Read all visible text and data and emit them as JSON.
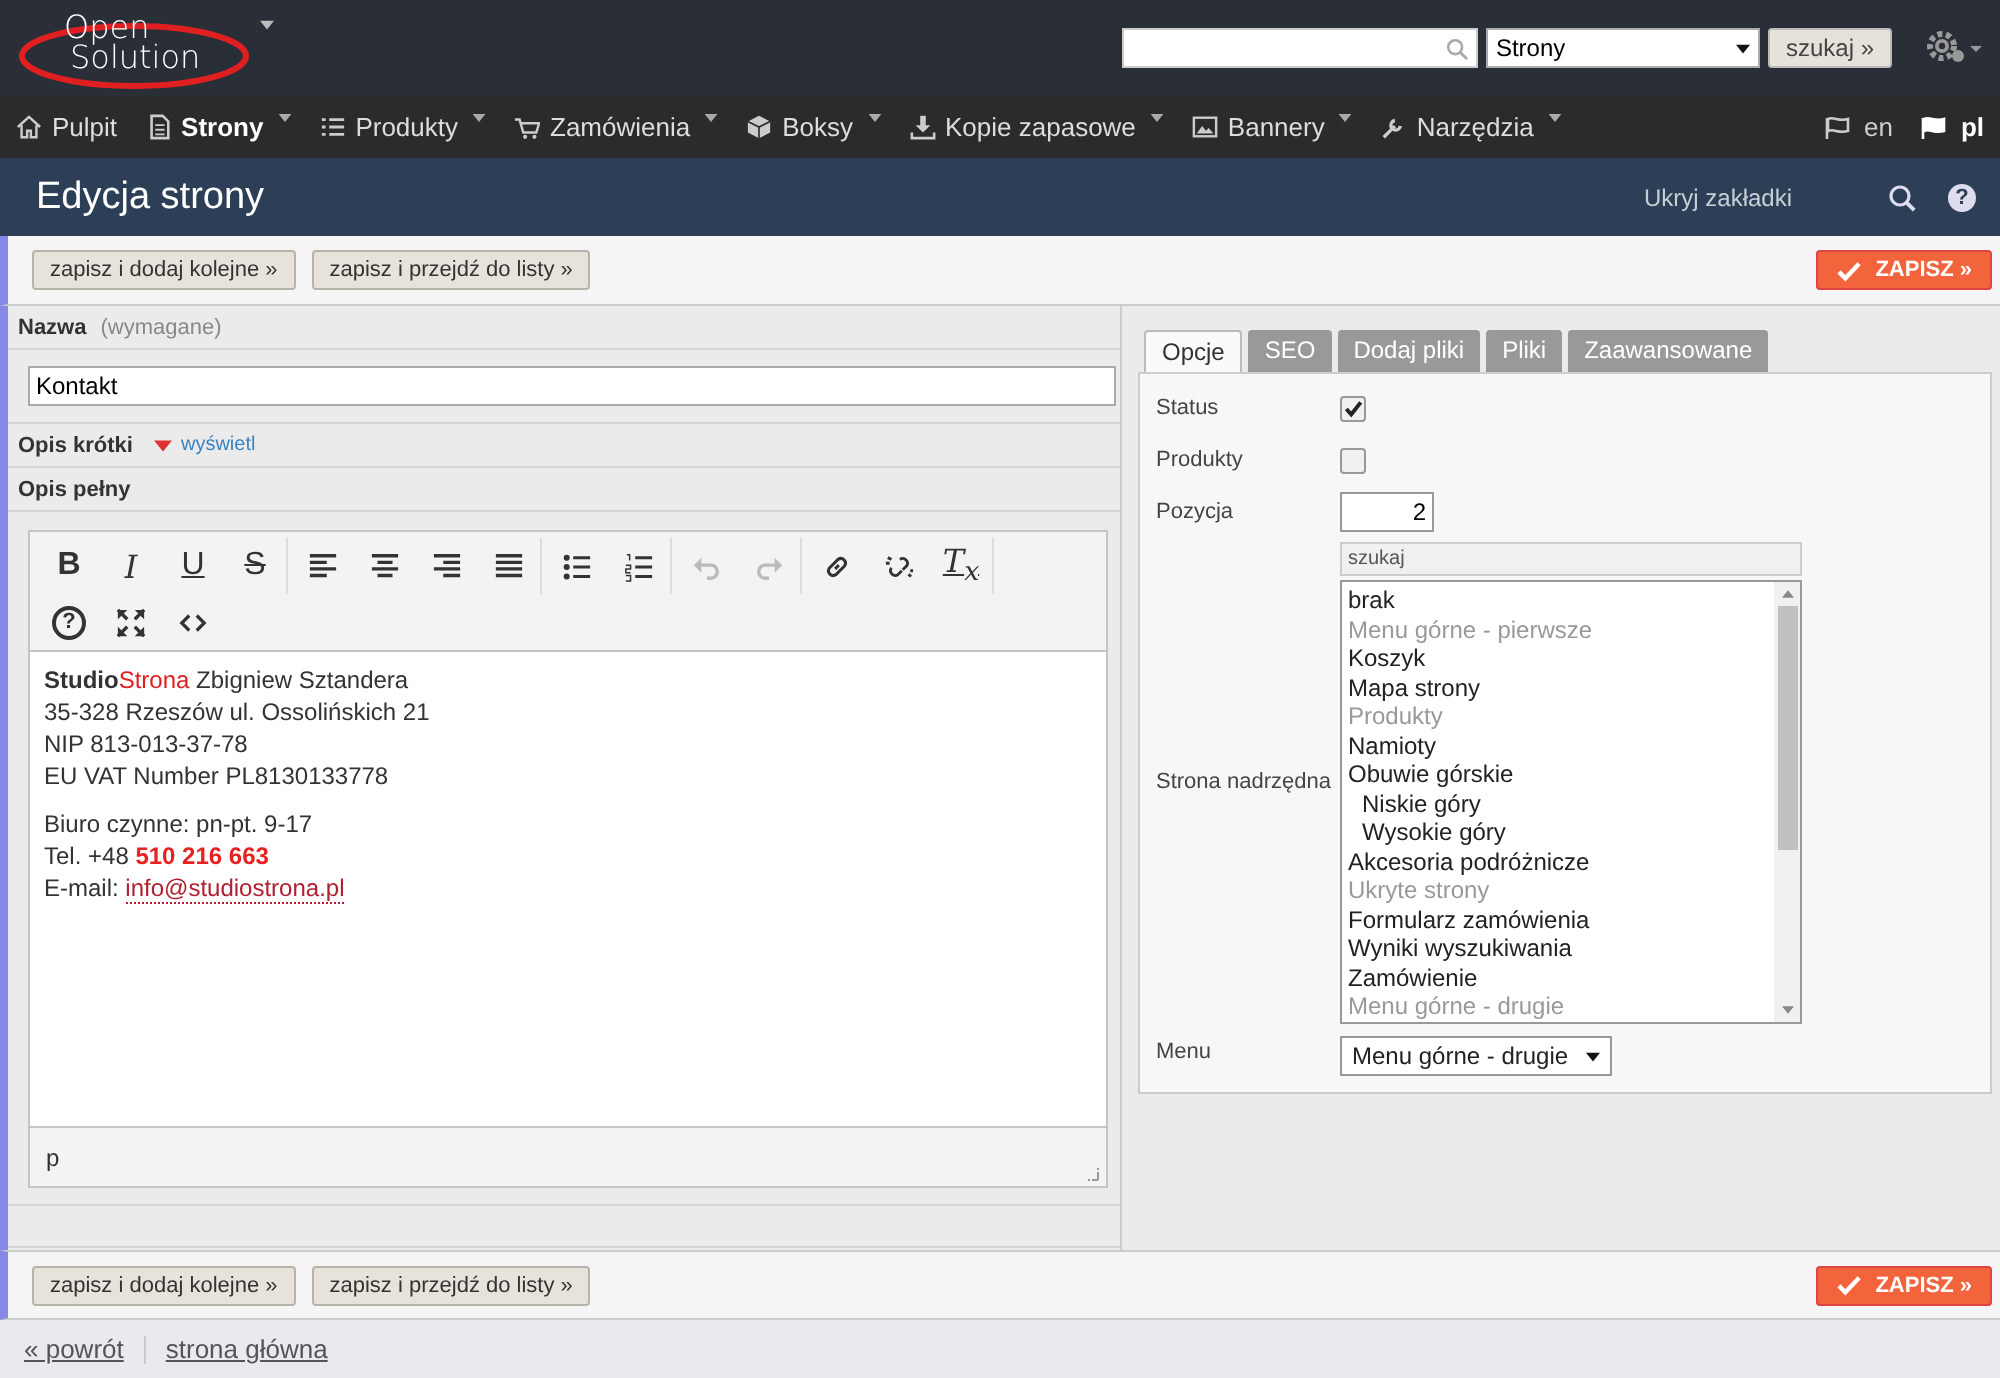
{
  "header": {
    "logo": [
      "Open",
      "Solution"
    ],
    "scope": "Strony",
    "search_button": "szukaj »"
  },
  "nav": {
    "items": [
      {
        "label": "Pulpit",
        "selected": false,
        "has_menu": false
      },
      {
        "label": "Strony",
        "selected": true,
        "has_menu": true
      },
      {
        "label": "Produkty",
        "selected": false,
        "has_menu": true
      },
      {
        "label": "Zamówienia",
        "selected": false,
        "has_menu": true
      },
      {
        "label": "Boksy",
        "selected": false,
        "has_menu": true
      },
      {
        "label": "Kopie zapasowe",
        "selected": false,
        "has_menu": true
      },
      {
        "label": "Bannery",
        "selected": false,
        "has_menu": true
      },
      {
        "label": "Narzędzia",
        "selected": false,
        "has_menu": true
      }
    ],
    "languages": [
      {
        "label": "en",
        "selected": false
      },
      {
        "label": "pl",
        "selected": true
      }
    ]
  },
  "title_bar": {
    "title": "Edycja strony",
    "hide_tabs": "Ukryj zakładki",
    "help": "?"
  },
  "actions": [
    "zapisz i dodaj kolejne »",
    "zapisz i przejdź do listy »"
  ],
  "save": "ZAPISZ »",
  "name_field": {
    "label": "Nazwa",
    "hint": "(wymagane)",
    "value": "Kontakt"
  },
  "short_description": {
    "label": "Opis krótki",
    "toggle": "wyświetl"
  },
  "full_description": {
    "label": "Opis pełny",
    "toolbar": [
      [
        {
          "glyph": "B",
          "disabled": false
        },
        {
          "glyph": "I",
          "disabled": false
        },
        {
          "glyph": "U",
          "disabled": false
        },
        {
          "glyph": "S",
          "disabled": false
        }
      ],
      [
        {
          "disabled": false
        },
        {
          "disabled": false
        },
        {
          "disabled": false
        },
        {
          "disabled": false
        }
      ],
      [
        {
          "disabled": false
        },
        {
          "disabled": false
        }
      ],
      [
        {
          "disabled": true
        },
        {
          "disabled": true
        }
      ],
      [
        {
          "disabled": false
        },
        {
          "disabled": false
        },
        {
          "glyph": "T$_{x}$",
          "disabled": false
        }
      ],
      [
        {
          "glyph": "?",
          "disabled": false
        },
        {
          "disabled": false
        },
        {
          "disabled": false
        }
      ]
    ],
    "content": [
      [
        [
          {
            "kind": "strong",
            "text": "Studio"
          },
          {
            "kind": "brand",
            "text": "Strona"
          },
          {
            "kind": "text",
            "text": " Zbigniew Sztandera"
          }
        ],
        [
          {
            "kind": "text",
            "text": "35-328 Rzeszów ul. Ossolińskich 21"
          }
        ],
        [
          {
            "kind": "text",
            "text": "NIP 813-013-37-78"
          }
        ],
        [
          {
            "kind": "text",
            "text": "EU VAT Number PL8130133778"
          }
        ]
      ],
      [
        [
          {
            "kind": "text",
            "text": "Biuro czynne: pn-pt. 9-17"
          }
        ],
        [
          {
            "kind": "text",
            "text": "Tel. +48 "
          },
          {
            "kind": "phone",
            "text": "510 216 663"
          }
        ],
        [
          {
            "kind": "text",
            "text": "E-mail: "
          },
          {
            "kind": "link",
            "text": "info@studiostrona.pl"
          }
        ]
      ]
    ],
    "path": "p"
  },
  "tabs": [
    {
      "label": "Opcje",
      "selected": true
    },
    {
      "label": "SEO",
      "selected": false
    },
    {
      "label": "Dodaj pliki",
      "selected": false
    },
    {
      "label": "Pliki",
      "selected": false
    },
    {
      "label": "Zaawansowane",
      "selected": false
    }
  ],
  "options": {
    "status": {
      "label": "Status",
      "checked": true
    },
    "products": {
      "label": "Produkty",
      "checked": false
    },
    "position": {
      "label": "Pozycja",
      "value": "2"
    },
    "parent": {
      "label": "Strona nadrzędna",
      "filter_placeholder": "szukaj",
      "items": [
        {
          "label": "brak",
          "disabled": false
        },
        {
          "label": "Menu górne - pierwsze",
          "disabled": true
        },
        {
          "label": "Koszyk",
          "disabled": false
        },
        {
          "label": "Mapa strony",
          "disabled": false
        },
        {
          "label": "Produkty",
          "disabled": true
        },
        {
          "label": "Namioty",
          "disabled": false
        },
        {
          "label": "Obuwie górskie",
          "disabled": false,
          "children": [
            {
              "label": "Niskie góry",
              "disabled": false
            },
            {
              "label": "Wysokie góry",
              "disabled": false
            }
          ]
        },
        {
          "label": "Akcesoria podróżnicze",
          "disabled": false
        },
        {
          "label": "Ukryte strony",
          "disabled": true
        },
        {
          "label": "Formularz zamówienia",
          "disabled": false
        },
        {
          "label": "Wyniki wyszukiwania",
          "disabled": false
        },
        {
          "label": "Zamówienie",
          "disabled": false
        },
        {
          "label": "Menu górne - drugie",
          "disabled": true
        }
      ]
    },
    "menu": {
      "label": "Menu",
      "value": "Menu górne - drugie"
    }
  },
  "bottom_actions": [
    "zapisz i dodaj kolejne »",
    "zapisz i przejdź do listy »"
  ],
  "bottom_save": "ZAPISZ »",
  "footer": [
    "« powrót",
    "strona główna"
  ]
}
